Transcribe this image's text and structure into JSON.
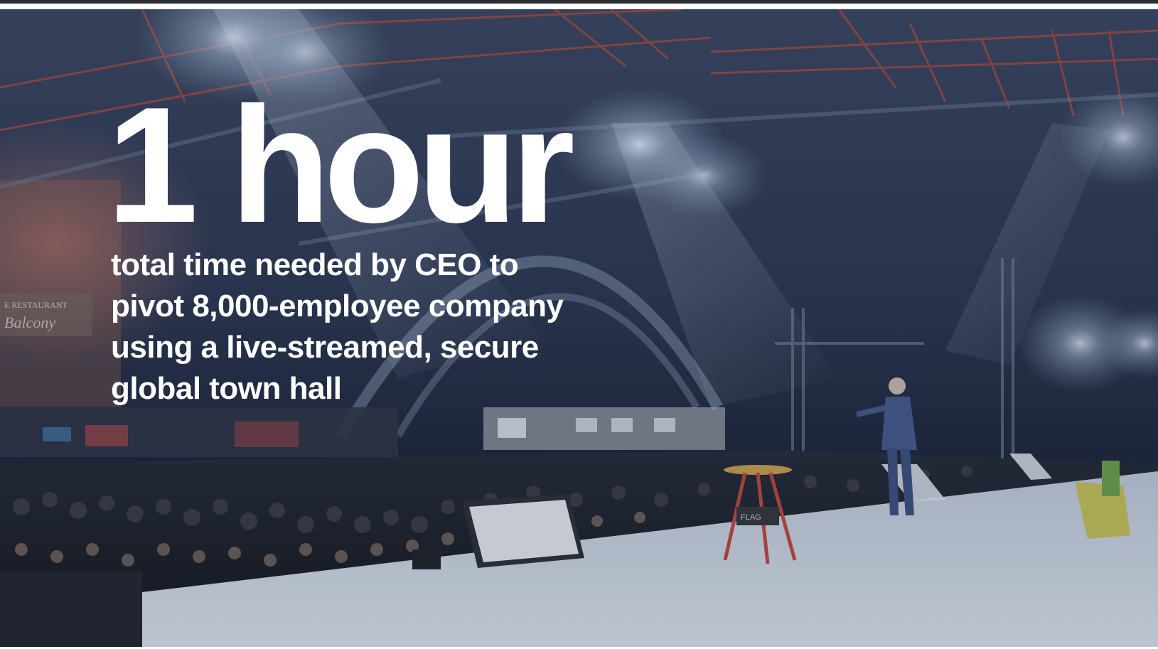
{
  "slide": {
    "stat_value": "1 hour",
    "caption_lines": [
      "total time needed by CEO to",
      "pivot 8,000-employee company",
      "using a live-streamed, secure",
      "global town hall"
    ]
  },
  "background_photo": {
    "venue_sign_lines": [
      "E RESTAURANT",
      "Balcony"
    ],
    "stage_sign": "FLAG"
  },
  "colors": {
    "text": "#ffffff",
    "overlay": "#1f2b45",
    "stage_floor": "#c9d3e0",
    "truss": "#b84a3a"
  }
}
